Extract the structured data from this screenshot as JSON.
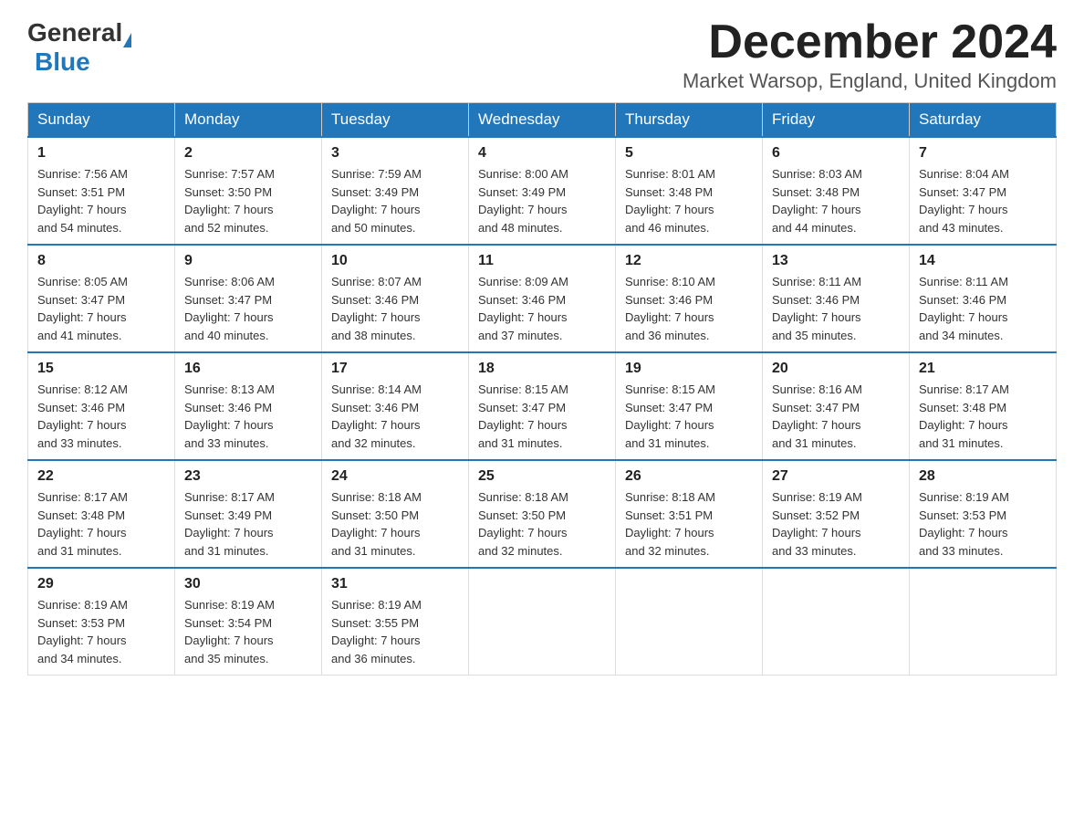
{
  "header": {
    "month_year": "December 2024",
    "location": "Market Warsop, England, United Kingdom",
    "logo_general": "General",
    "logo_blue": "Blue"
  },
  "weekdays": [
    "Sunday",
    "Monday",
    "Tuesday",
    "Wednesday",
    "Thursday",
    "Friday",
    "Saturday"
  ],
  "weeks": [
    [
      {
        "day": "1",
        "info": "Sunrise: 7:56 AM\nSunset: 3:51 PM\nDaylight: 7 hours\nand 54 minutes."
      },
      {
        "day": "2",
        "info": "Sunrise: 7:57 AM\nSunset: 3:50 PM\nDaylight: 7 hours\nand 52 minutes."
      },
      {
        "day": "3",
        "info": "Sunrise: 7:59 AM\nSunset: 3:49 PM\nDaylight: 7 hours\nand 50 minutes."
      },
      {
        "day": "4",
        "info": "Sunrise: 8:00 AM\nSunset: 3:49 PM\nDaylight: 7 hours\nand 48 minutes."
      },
      {
        "day": "5",
        "info": "Sunrise: 8:01 AM\nSunset: 3:48 PM\nDaylight: 7 hours\nand 46 minutes."
      },
      {
        "day": "6",
        "info": "Sunrise: 8:03 AM\nSunset: 3:48 PM\nDaylight: 7 hours\nand 44 minutes."
      },
      {
        "day": "7",
        "info": "Sunrise: 8:04 AM\nSunset: 3:47 PM\nDaylight: 7 hours\nand 43 minutes."
      }
    ],
    [
      {
        "day": "8",
        "info": "Sunrise: 8:05 AM\nSunset: 3:47 PM\nDaylight: 7 hours\nand 41 minutes."
      },
      {
        "day": "9",
        "info": "Sunrise: 8:06 AM\nSunset: 3:47 PM\nDaylight: 7 hours\nand 40 minutes."
      },
      {
        "day": "10",
        "info": "Sunrise: 8:07 AM\nSunset: 3:46 PM\nDaylight: 7 hours\nand 38 minutes."
      },
      {
        "day": "11",
        "info": "Sunrise: 8:09 AM\nSunset: 3:46 PM\nDaylight: 7 hours\nand 37 minutes."
      },
      {
        "day": "12",
        "info": "Sunrise: 8:10 AM\nSunset: 3:46 PM\nDaylight: 7 hours\nand 36 minutes."
      },
      {
        "day": "13",
        "info": "Sunrise: 8:11 AM\nSunset: 3:46 PM\nDaylight: 7 hours\nand 35 minutes."
      },
      {
        "day": "14",
        "info": "Sunrise: 8:11 AM\nSunset: 3:46 PM\nDaylight: 7 hours\nand 34 minutes."
      }
    ],
    [
      {
        "day": "15",
        "info": "Sunrise: 8:12 AM\nSunset: 3:46 PM\nDaylight: 7 hours\nand 33 minutes."
      },
      {
        "day": "16",
        "info": "Sunrise: 8:13 AM\nSunset: 3:46 PM\nDaylight: 7 hours\nand 33 minutes."
      },
      {
        "day": "17",
        "info": "Sunrise: 8:14 AM\nSunset: 3:46 PM\nDaylight: 7 hours\nand 32 minutes."
      },
      {
        "day": "18",
        "info": "Sunrise: 8:15 AM\nSunset: 3:47 PM\nDaylight: 7 hours\nand 31 minutes."
      },
      {
        "day": "19",
        "info": "Sunrise: 8:15 AM\nSunset: 3:47 PM\nDaylight: 7 hours\nand 31 minutes."
      },
      {
        "day": "20",
        "info": "Sunrise: 8:16 AM\nSunset: 3:47 PM\nDaylight: 7 hours\nand 31 minutes."
      },
      {
        "day": "21",
        "info": "Sunrise: 8:17 AM\nSunset: 3:48 PM\nDaylight: 7 hours\nand 31 minutes."
      }
    ],
    [
      {
        "day": "22",
        "info": "Sunrise: 8:17 AM\nSunset: 3:48 PM\nDaylight: 7 hours\nand 31 minutes."
      },
      {
        "day": "23",
        "info": "Sunrise: 8:17 AM\nSunset: 3:49 PM\nDaylight: 7 hours\nand 31 minutes."
      },
      {
        "day": "24",
        "info": "Sunrise: 8:18 AM\nSunset: 3:50 PM\nDaylight: 7 hours\nand 31 minutes."
      },
      {
        "day": "25",
        "info": "Sunrise: 8:18 AM\nSunset: 3:50 PM\nDaylight: 7 hours\nand 32 minutes."
      },
      {
        "day": "26",
        "info": "Sunrise: 8:18 AM\nSunset: 3:51 PM\nDaylight: 7 hours\nand 32 minutes."
      },
      {
        "day": "27",
        "info": "Sunrise: 8:19 AM\nSunset: 3:52 PM\nDaylight: 7 hours\nand 33 minutes."
      },
      {
        "day": "28",
        "info": "Sunrise: 8:19 AM\nSunset: 3:53 PM\nDaylight: 7 hours\nand 33 minutes."
      }
    ],
    [
      {
        "day": "29",
        "info": "Sunrise: 8:19 AM\nSunset: 3:53 PM\nDaylight: 7 hours\nand 34 minutes."
      },
      {
        "day": "30",
        "info": "Sunrise: 8:19 AM\nSunset: 3:54 PM\nDaylight: 7 hours\nand 35 minutes."
      },
      {
        "day": "31",
        "info": "Sunrise: 8:19 AM\nSunset: 3:55 PM\nDaylight: 7 hours\nand 36 minutes."
      },
      {
        "day": "",
        "info": ""
      },
      {
        "day": "",
        "info": ""
      },
      {
        "day": "",
        "info": ""
      },
      {
        "day": "",
        "info": ""
      }
    ]
  ]
}
